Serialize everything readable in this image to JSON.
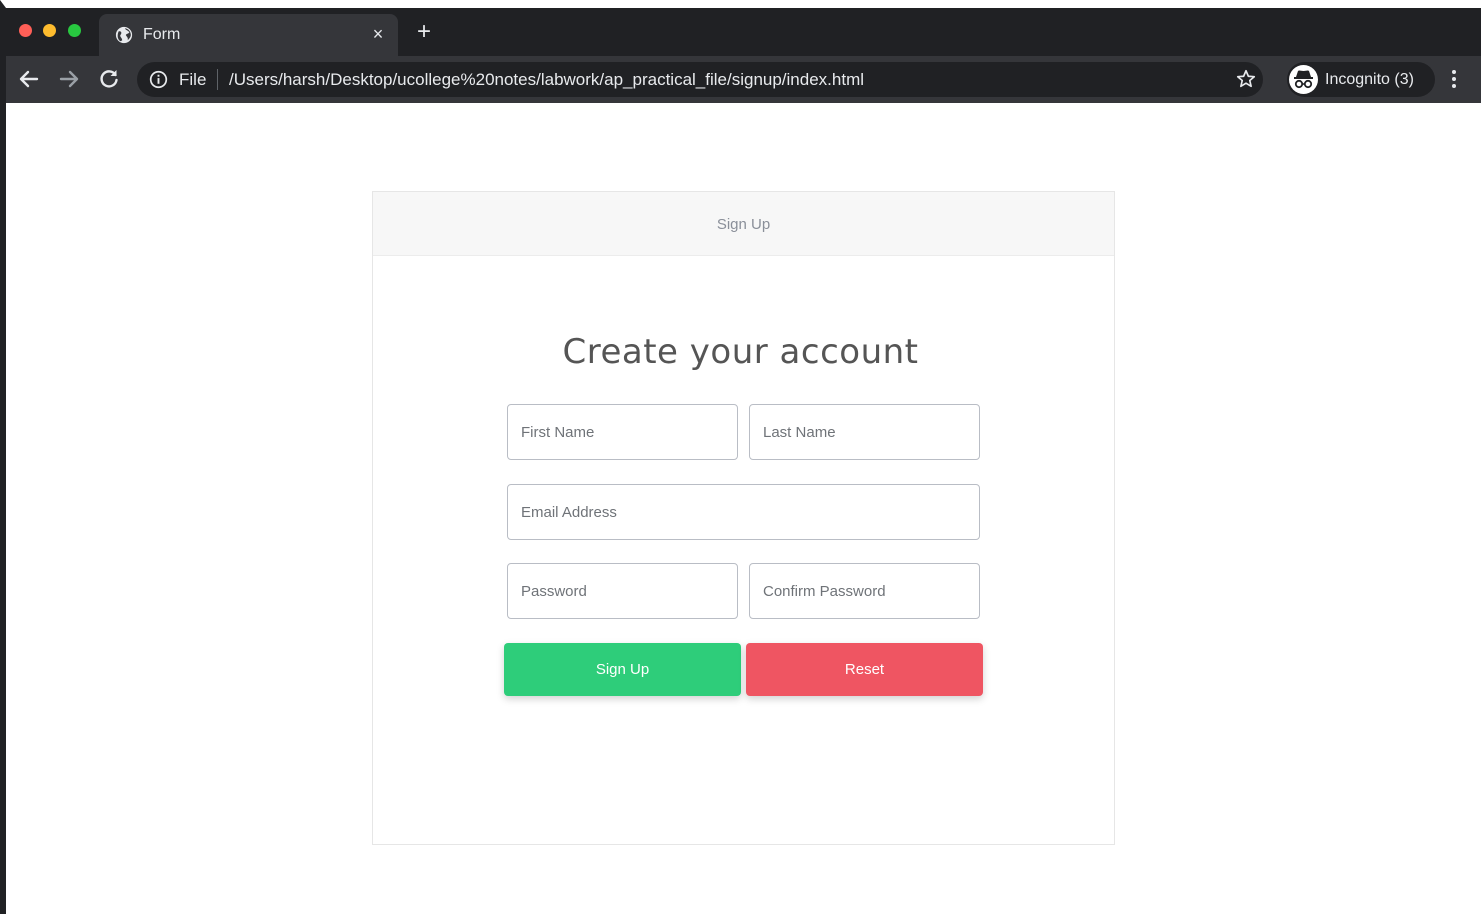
{
  "browser": {
    "tab": {
      "title": "Form",
      "close_glyph": "×"
    },
    "new_tab_glyph": "+",
    "address": {
      "scheme": "File",
      "url": "/Users/harsh/Desktop/ucollege%20notes/labwork/ap_practical_file/signup/index.html"
    },
    "profile": {
      "label": "Incognito (3)"
    },
    "icons": {
      "tab": "globe-icon",
      "back": "arrow-left-icon",
      "forward": "arrow-right-icon",
      "reload": "reload-icon",
      "info": "info-icon",
      "bookmark": "star-icon",
      "incognito": "incognito-icon",
      "menu": "three-dots-icon"
    }
  },
  "card": {
    "header_title": "Sign Up"
  },
  "form": {
    "heading": "Create your account",
    "first_name": {
      "placeholder": "First Name",
      "value": ""
    },
    "last_name": {
      "placeholder": "Last Name",
      "value": ""
    },
    "email": {
      "placeholder": "Email Address",
      "value": ""
    },
    "password": {
      "placeholder": "Password",
      "value": ""
    },
    "confirm_password": {
      "placeholder": "Confirm Password",
      "value": ""
    },
    "signup_label": "Sign Up",
    "reset_label": "Reset"
  },
  "colors": {
    "chrome_dark": "#202124",
    "chrome_toolbar": "#35363a",
    "signup_green": "#2ecd7a",
    "reset_red": "#ef5562"
  }
}
